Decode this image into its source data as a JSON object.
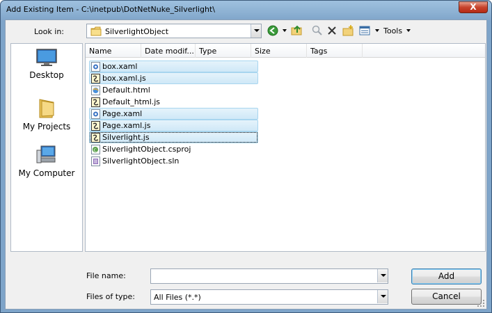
{
  "window": {
    "title": "Add Existing Item - C:\\inetpub\\DotNetNuke_Silverlight\\",
    "close_glyph": "X"
  },
  "lookin": {
    "label": "Look in:",
    "value": "SilverlightObject"
  },
  "toolbar": {
    "tools_label": "Tools"
  },
  "places": [
    {
      "label": "Desktop",
      "icon": "desktop-icon"
    },
    {
      "label": "My Projects",
      "icon": "folder-icon"
    },
    {
      "label": "My Computer",
      "icon": "computer-icon"
    }
  ],
  "columns": [
    "Name",
    "Date modif...",
    "Type",
    "Size",
    "Tags"
  ],
  "files": [
    {
      "name": "box.xaml",
      "icon": "xaml-file-icon",
      "selected": true
    },
    {
      "name": "box.xaml.js",
      "icon": "js-file-icon",
      "selected": true
    },
    {
      "name": "Default.html",
      "icon": "html-file-icon",
      "selected": false
    },
    {
      "name": "Default_html.js",
      "icon": "js-file-icon",
      "selected": false
    },
    {
      "name": "Page.xaml",
      "icon": "xaml-file-icon",
      "selected": true
    },
    {
      "name": "Page.xaml.js",
      "icon": "js-file-icon",
      "selected": true
    },
    {
      "name": "Silverlight.js",
      "icon": "js-file-icon",
      "selected": true,
      "focused": true
    },
    {
      "name": "SilverlightObject.csproj",
      "icon": "csproj-file-icon",
      "selected": false
    },
    {
      "name": "SilverlightObject.sln",
      "icon": "sln-file-icon",
      "selected": false
    }
  ],
  "form": {
    "file_name_label": "File name:",
    "file_name_value": "",
    "file_type_label": "Files of type:",
    "file_type_value": "All Files (*.*)"
  },
  "buttons": {
    "add": "Add",
    "cancel": "Cancel"
  },
  "colors": {
    "selection_fill": "#cfe8f7",
    "selection_border": "#a7d5ef",
    "frame": "#7ea4c9",
    "close_red": "#c7432c"
  }
}
